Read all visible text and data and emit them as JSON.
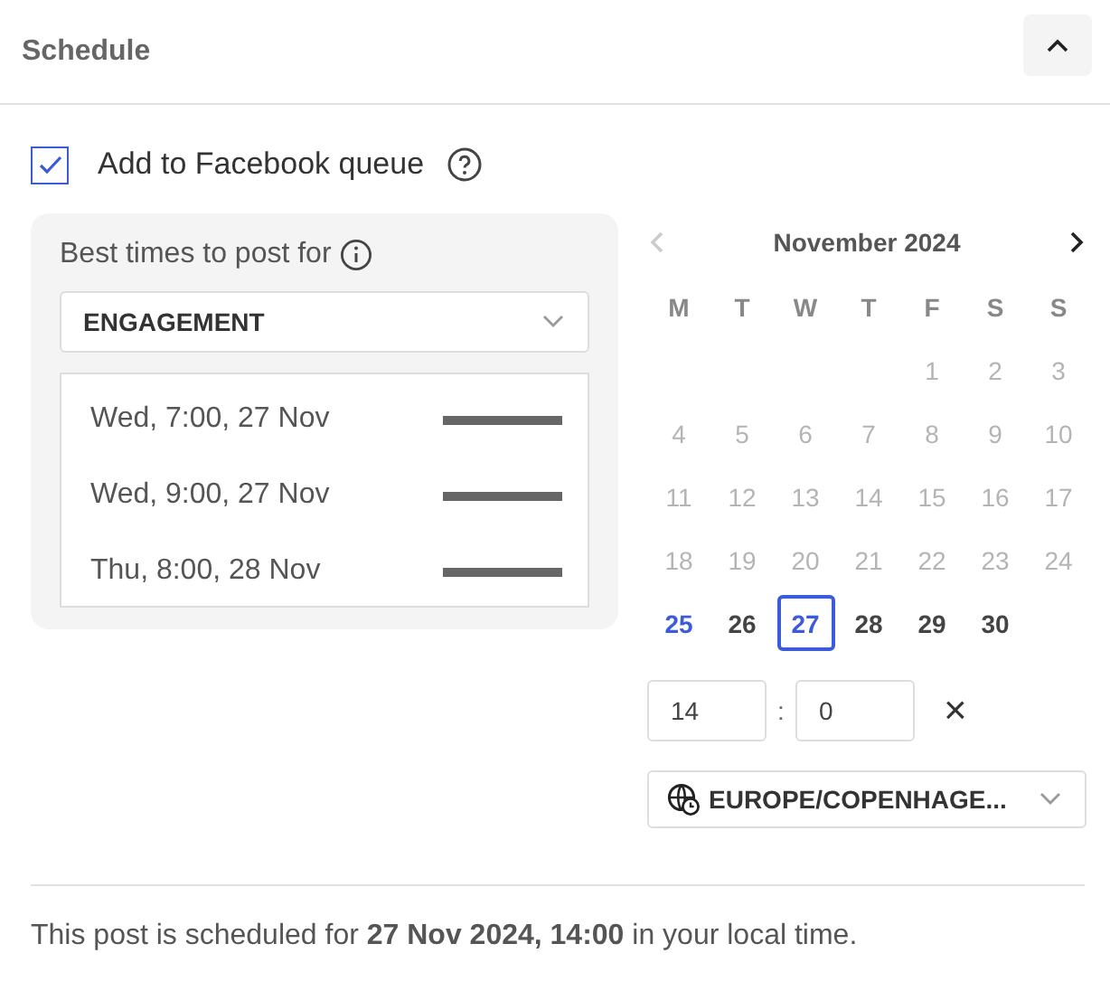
{
  "header": {
    "title": "Schedule",
    "collapse_expanded": true
  },
  "queue": {
    "label": "Add to Facebook queue",
    "checked": true
  },
  "best_times": {
    "title": "Best times to post for",
    "metric": "ENGAGEMENT",
    "times": [
      {
        "label": "Wed, 7:00, 27 Nov",
        "level": 1
      },
      {
        "label": "Wed, 9:00, 27 Nov",
        "level": 1
      },
      {
        "label": "Thu, 8:00, 28 Nov",
        "level": 1
      }
    ]
  },
  "calendar": {
    "month": "November 2024",
    "prev_disabled": true,
    "weekdays": [
      "M",
      "T",
      "W",
      "T",
      "F",
      "S",
      "S"
    ],
    "weeks": [
      [
        {
          "day": "1",
          "disabled": true,
          "today": false,
          "selected": false
        },
        {
          "day": "2",
          "disabled": true,
          "today": false,
          "selected": false
        },
        {
          "day": "3",
          "disabled": true,
          "today": false,
          "selected": false
        }
      ],
      [
        {
          "day": "4",
          "disabled": true,
          "today": false,
          "selected": false
        },
        {
          "day": "5",
          "disabled": true,
          "today": false,
          "selected": false
        },
        {
          "day": "6",
          "disabled": true,
          "today": false,
          "selected": false
        },
        {
          "day": "7",
          "disabled": true,
          "today": false,
          "selected": false
        },
        {
          "day": "8",
          "disabled": true,
          "today": false,
          "selected": false
        },
        {
          "day": "9",
          "disabled": true,
          "today": false,
          "selected": false
        },
        {
          "day": "10",
          "disabled": true,
          "today": false,
          "selected": false
        }
      ],
      [
        {
          "day": "11",
          "disabled": true,
          "today": false,
          "selected": false
        },
        {
          "day": "12",
          "disabled": true,
          "today": false,
          "selected": false
        },
        {
          "day": "13",
          "disabled": true,
          "today": false,
          "selected": false
        },
        {
          "day": "14",
          "disabled": true,
          "today": false,
          "selected": false
        },
        {
          "day": "15",
          "disabled": true,
          "today": false,
          "selected": false
        },
        {
          "day": "16",
          "disabled": true,
          "today": false,
          "selected": false
        },
        {
          "day": "17",
          "disabled": true,
          "today": false,
          "selected": false
        }
      ],
      [
        {
          "day": "18",
          "disabled": true,
          "today": false,
          "selected": false
        },
        {
          "day": "19",
          "disabled": true,
          "today": false,
          "selected": false
        },
        {
          "day": "20",
          "disabled": true,
          "today": false,
          "selected": false
        },
        {
          "day": "21",
          "disabled": true,
          "today": false,
          "selected": false
        },
        {
          "day": "22",
          "disabled": true,
          "today": false,
          "selected": false
        },
        {
          "day": "23",
          "disabled": true,
          "today": false,
          "selected": false
        },
        {
          "day": "24",
          "disabled": true,
          "today": false,
          "selected": false
        }
      ],
      [
        {
          "day": "25",
          "disabled": false,
          "today": true,
          "selected": false
        },
        {
          "day": "26",
          "disabled": false,
          "today": false,
          "selected": false
        },
        {
          "day": "27",
          "disabled": false,
          "today": false,
          "selected": true
        },
        {
          "day": "28",
          "disabled": false,
          "today": false,
          "selected": false
        },
        {
          "day": "29",
          "disabled": false,
          "today": false,
          "selected": false
        },
        {
          "day": "30",
          "disabled": false,
          "today": false,
          "selected": false
        }
      ]
    ]
  },
  "time": {
    "hour": "14",
    "separator": ":",
    "minute": "0",
    "clear": "×"
  },
  "timezone": {
    "value": "EUROPE/COPENHAGE..."
  },
  "footer": {
    "text": "This post is scheduled for **27 Nov 2024, 14:00** in your local time."
  }
}
